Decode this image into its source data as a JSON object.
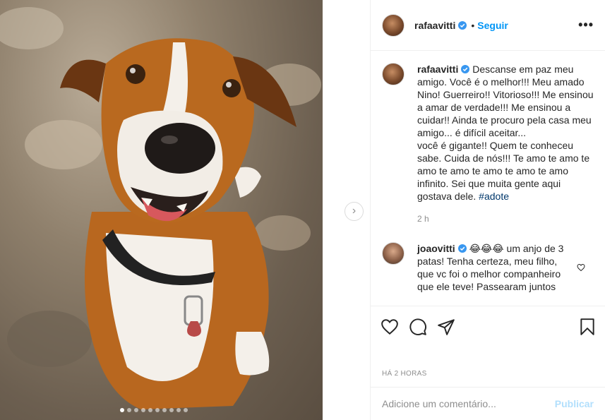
{
  "post": {
    "carousel": {
      "slide_count": 10,
      "active_index": 0,
      "next_glyph": "›"
    }
  },
  "header": {
    "username": "rafaavitti",
    "separator": "•",
    "follow_label": "Seguir",
    "more_glyph": "•••"
  },
  "caption": {
    "username": "rafaavitti",
    "text": "Descanse em paz meu amigo. Você é o melhor!!! Meu amado Nino! Guerreiro!! Vitorioso!!! Me ensinou a amar de verdade!!! Me ensinou a cuidar!! Ainda te procuro pela casa meu amigo... é difícil aceitar...\nvocê é gigante!! Quem te conheceu sabe. Cuida de nós!!! Te amo te amo te amo te amo te amo te amo te amo infinito. Sei que muita gente aqui gostava dele. ",
    "hashtag": "#adote",
    "time": "2 h"
  },
  "comments": [
    {
      "username": "joaovitti",
      "text": "😂😂😂 um anjo de 3 patas! Tenha certeza, meu filho, que vc foi o melhor companheiro que ele teve! Passearam juntos"
    }
  ],
  "footer": {
    "date": "HÁ 2 HORAS",
    "comment_placeholder": "Adicione um comentário...",
    "publish_label": "Publicar"
  },
  "colors": {
    "accent": "#0095f6",
    "verified": "#3897f0",
    "publish_disabled": "#b2dffc",
    "muted": "#8e8e8e"
  },
  "icons": [
    "verified-badge-icon",
    "more-options-icon",
    "heart-icon",
    "comment-icon",
    "share-icon",
    "bookmark-icon",
    "chevron-right-icon"
  ]
}
